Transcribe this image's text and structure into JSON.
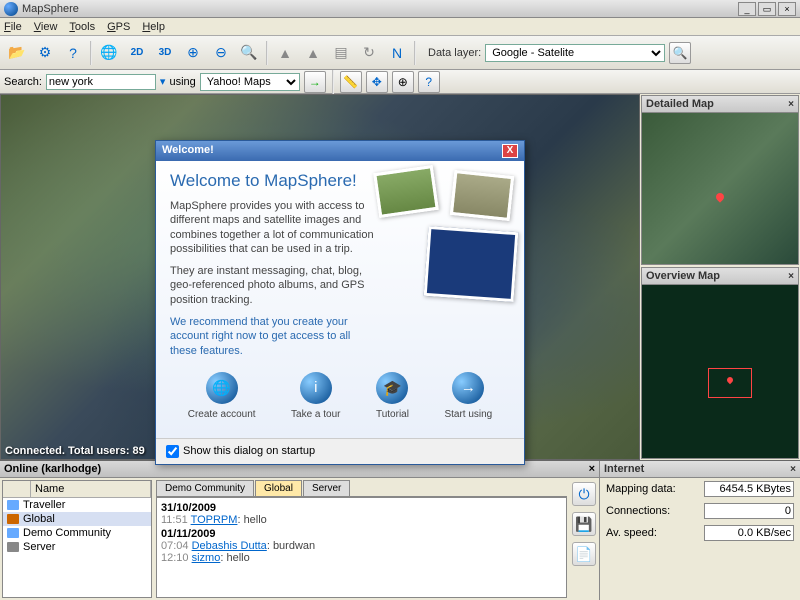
{
  "title": "MapSphere",
  "menu": [
    "File",
    "View",
    "Tools",
    "GPS",
    "Help"
  ],
  "datalayer": {
    "label": "Data layer:",
    "value": "Google - Satelite"
  },
  "search": {
    "label": "Search:",
    "value": "new york",
    "using": "using",
    "engine": "Yahoo! Maps"
  },
  "status": "Connected.  Total users: 89",
  "panels": {
    "detailed": "Detailed Map",
    "overview": "Overview Map",
    "internet": "Internet"
  },
  "internet": {
    "mapping_label": "Mapping data:",
    "mapping_val": "6454.5 KBytes",
    "conn_label": "Connections:",
    "conn_val": "0",
    "speed_label": "Av. speed:",
    "speed_val": "0.0 KB/sec"
  },
  "online": {
    "title": "Online (karlhodge)",
    "cols": [
      "",
      "Name"
    ],
    "users": [
      "Traveller",
      "Global",
      "Demo Community",
      "Server"
    ],
    "tabs": [
      "Demo Community",
      "Global",
      "Server"
    ],
    "log": [
      {
        "date": "31/10/2009",
        "time": "11:51",
        "user": "TOPRPM",
        "text": "hello"
      },
      {
        "date": "01/11/2009",
        "time": "07:04",
        "user": "Debashis Dutta",
        "text": "burdwan"
      },
      {
        "date": "",
        "time": "12:10",
        "user": "sizmo",
        "text": "hello"
      }
    ]
  },
  "dialog": {
    "title": "Welcome!",
    "heading": "Welcome to MapSphere!",
    "p1": "MapSphere provides you with access to different maps and satellite images and combines together a lot of communication possibilities that can be used in a trip.",
    "p2": "They are instant messaging, chat, blog, geo-referenced photo albums, and GPS position tracking.",
    "rec": "We recommend that you create your account right now to get access to all these features.",
    "actions": [
      "Create account",
      "Take a tour",
      "Tutorial",
      "Start using"
    ],
    "checkbox": "Show this dialog on startup"
  }
}
